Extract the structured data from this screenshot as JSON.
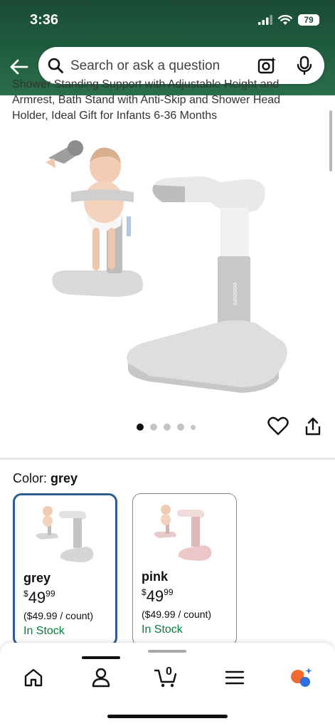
{
  "status_bar": {
    "time": "3:36",
    "battery": "79"
  },
  "search": {
    "placeholder": "Search or ask a question"
  },
  "product": {
    "title_lines": [
      "Shower Standing Support with Adjustable Height and",
      "Armrest, Bath Stand with Anti-Skip and Shower Head",
      "Holder, Ideal Gift for Infants 6-36 Months"
    ],
    "image_dots": 5,
    "active_dot": 0
  },
  "color_selector": {
    "label": "Color:",
    "selected": "grey",
    "options": [
      {
        "name": "grey",
        "currency": "$",
        "price_whole": "49",
        "price_fraction": "99",
        "unit_price": "($49.99 / count)",
        "availability": "In Stock",
        "selected": true
      },
      {
        "name": "pink",
        "currency": "$",
        "price_whole": "49",
        "price_fraction": "99",
        "unit_price": "($49.99 / count)",
        "availability": "In Stock",
        "selected": false
      }
    ]
  },
  "bottom_nav": {
    "items": [
      "home-icon",
      "account-icon",
      "cart-icon",
      "menu-icon",
      "rufus-assistant-icon"
    ],
    "cart_count": "0",
    "active_index": 1
  },
  "colors": {
    "header_green": "#1e5a3e",
    "in_stock_green": "#067d3f",
    "selected_border": "#2f5f8f",
    "assistant_orange": "#f26a2e",
    "assistant_blue": "#2d6fe0"
  }
}
